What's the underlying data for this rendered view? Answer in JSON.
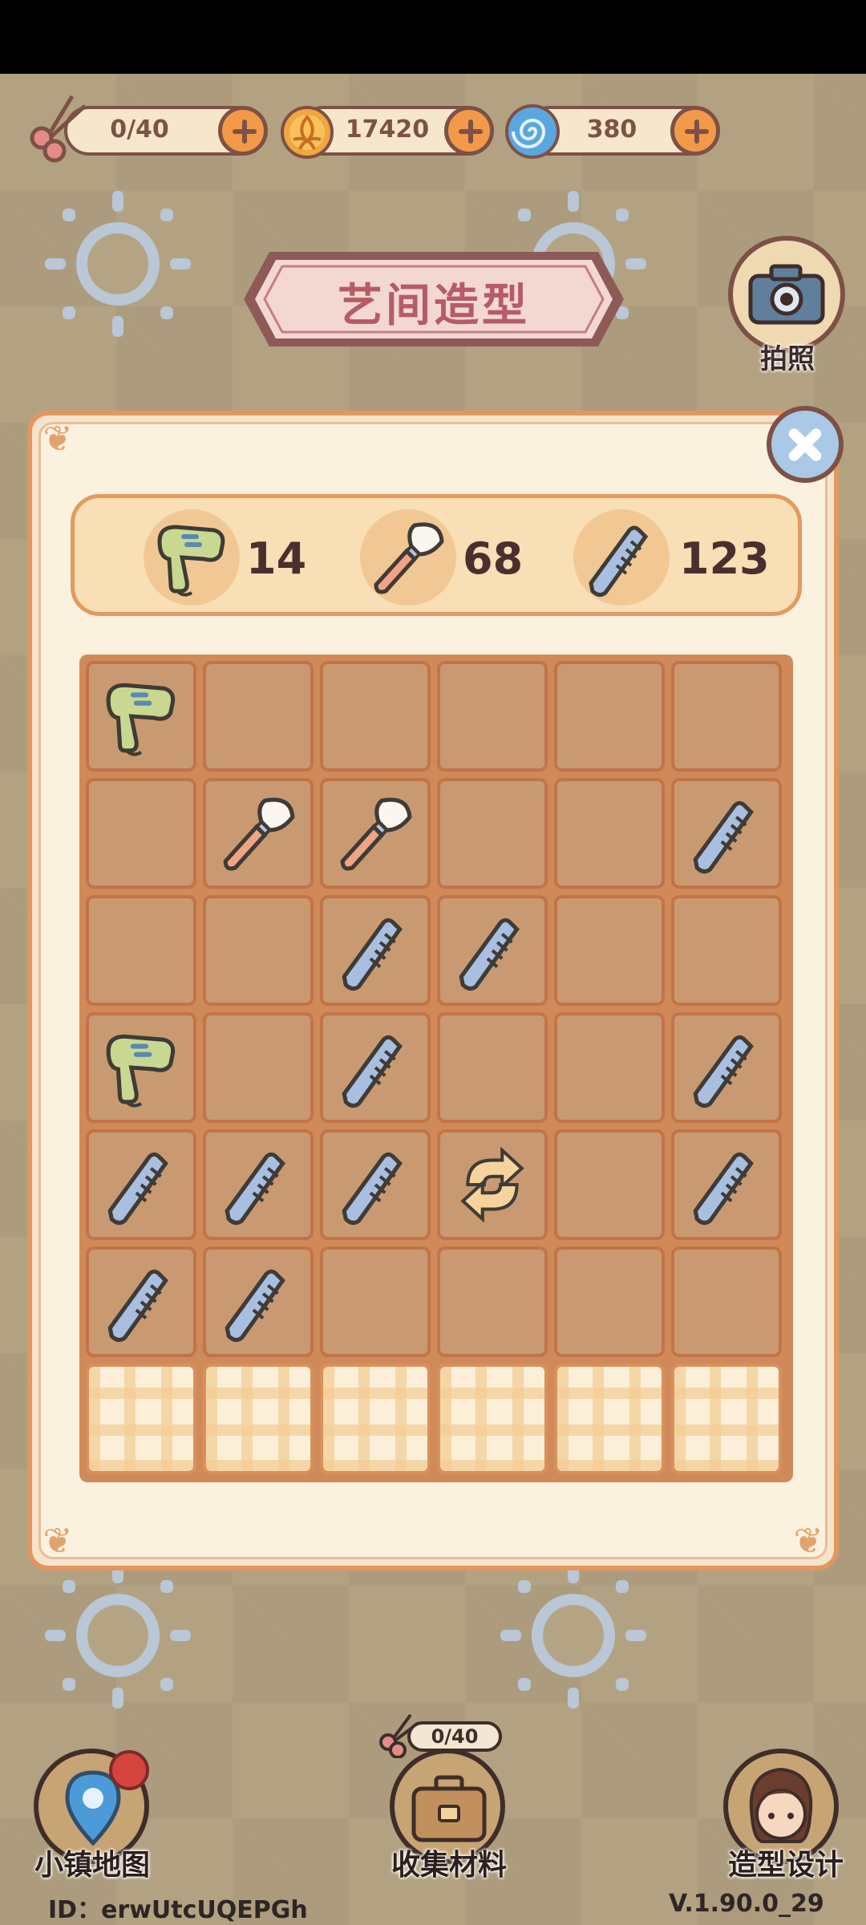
{
  "header": {
    "scissors_counter": "0/40",
    "coins": "17420",
    "spiral_currency": "380",
    "title": "艺间造型",
    "camera_label": "拍照"
  },
  "tool_counts": [
    {
      "icon": "hair-dryer-icon",
      "count": "14"
    },
    {
      "icon": "makeup-brush-icon",
      "count": "68"
    },
    {
      "icon": "comb-icon",
      "count": "123"
    }
  ],
  "grid": {
    "rows": [
      [
        "dryer",
        "",
        "",
        "",
        "",
        ""
      ],
      [
        "",
        "brush",
        "brush",
        "",
        "",
        "comb"
      ],
      [
        "",
        "",
        "comb",
        "comb",
        "",
        ""
      ],
      [
        "dryer",
        "",
        "comb",
        "",
        "",
        "comb"
      ],
      [
        "comb",
        "comb",
        "comb",
        "refresh",
        "",
        "comb"
      ],
      [
        "comb",
        "comb",
        "",
        "",
        "",
        ""
      ],
      [
        "plaid",
        "plaid",
        "plaid",
        "plaid",
        "plaid",
        "plaid"
      ]
    ]
  },
  "bottom_nav": {
    "map_label": "小镇地图",
    "collect_label": "收集材料",
    "collect_counter": "0/40",
    "design_label": "造型设计"
  },
  "footer": {
    "id_text": "ID：erwUtcUQEPGh",
    "version": "V.1.90.0_29"
  },
  "colors": {
    "panel_border": "#e1975f",
    "grid_bg": "#d08a59",
    "cell": "#c99a71",
    "accent_plus": "#f29a49"
  }
}
